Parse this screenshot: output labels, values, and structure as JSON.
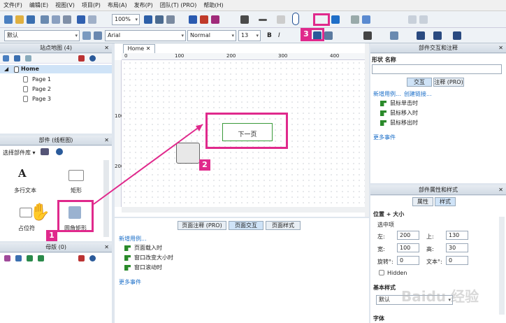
{
  "menu": [
    "文件(F)",
    "编辑(E)",
    "视图(V)",
    "项目(P)",
    "布局(A)",
    "发布(P)",
    "团队(T) (PRO)",
    "帮助(H)"
  ],
  "toolbar": {
    "zoom": "100%"
  },
  "format": {
    "style": "默认",
    "font": "Arial",
    "weight": "Normal",
    "size": "13"
  },
  "sitemap": {
    "title": "站点地图 (4)",
    "root": "Home",
    "pages": [
      "Page 1",
      "Page 2",
      "Page 3"
    ]
  },
  "widgets": {
    "title": "部件 (线框图)",
    "select": "选择部件库 ▾",
    "items": [
      "多行文本",
      "矩形",
      "占位符",
      "圆角矩形"
    ]
  },
  "masters": {
    "title": "母版 (0)"
  },
  "canvas": {
    "tab": "Home",
    "ruler_x": [
      "0",
      "100",
      "200",
      "300",
      "400"
    ],
    "ruler_y": [
      "100",
      "200"
    ],
    "button_text": "下一页"
  },
  "page_props": {
    "tabs": [
      "页面注释 (PRO)",
      "页面交互",
      "页面样式"
    ],
    "new_case": "新增用例...",
    "events": [
      "页面载入时",
      "窗口改变大小时",
      "窗口滚动时"
    ],
    "more": "更多事件"
  },
  "interactions": {
    "title": "部件交互和注释",
    "shape_label": "形状 名称",
    "tabs": [
      "交互",
      "注释 (PRO)"
    ],
    "new_case": "新增用例...",
    "create_link": "创建链接...",
    "events": [
      "鼠标单击时",
      "鼠标移入时",
      "鼠标移出时"
    ],
    "more": "更多事件"
  },
  "props": {
    "title": "部件属性和样式",
    "tabs": [
      "属性",
      "样式"
    ],
    "section": "位置 + 大小",
    "selected": "选中项",
    "left_label": "左:",
    "left": "200",
    "top_label": "上:",
    "top": "130",
    "width_label": "宽:",
    "width": "100",
    "height_label": "高:",
    "height": "30",
    "rotate_label": "旋转°:",
    "rotate": "0",
    "text_label": "文本°:",
    "text": "0",
    "hidden": "Hidden",
    "base_style": "基本样式",
    "style_value": "默认",
    "font_section": "字体"
  },
  "badges": [
    "1",
    "2",
    "3"
  ],
  "watermark": "Baidu 经验"
}
